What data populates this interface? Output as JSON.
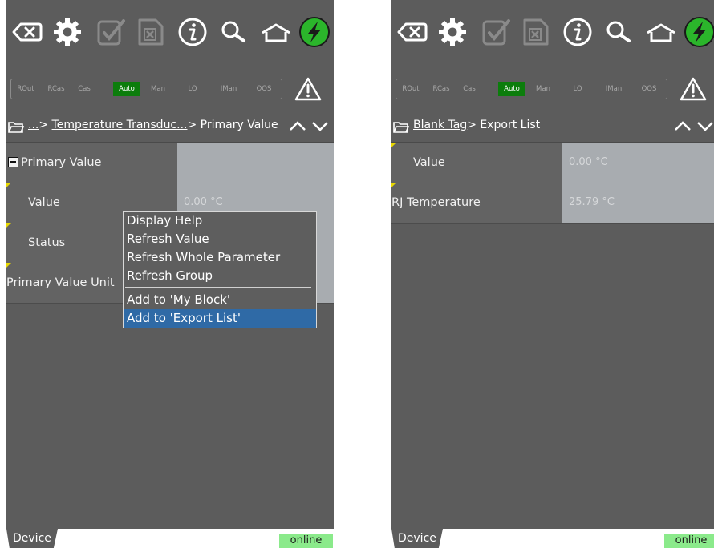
{
  "toolbar": {
    "icons": [
      "backspace-icon",
      "gear-icon",
      "check-document-icon",
      "cancel-document-icon",
      "info-icon",
      "search-icon",
      "home-icon",
      "lightning-icon"
    ]
  },
  "modes": [
    "ROut",
    "RCas",
    "Cas",
    "Auto",
    "Man",
    "LO",
    "IMan",
    "OOS"
  ],
  "active_mode": "Auto",
  "colors": {
    "active_mode": "#0c7d0c",
    "online": "#8bea8b",
    "menu_selected": "#2f6aa6",
    "flag": "#e8d800"
  },
  "left": {
    "breadcrumb": {
      "ellipsis": "...",
      "link": "Temperature Transduc...",
      "sep1": "> ",
      "sep2": "> ",
      "current": "Primary Value"
    },
    "rows": [
      {
        "label": "Primary Value",
        "value": ""
      },
      {
        "label": "Value",
        "value": "0.00 °C"
      },
      {
        "label": "Status",
        "value": ""
      },
      {
        "label": "Primary Value Unit",
        "value": ""
      }
    ],
    "context_menu": {
      "items": [
        "Display Help",
        "Refresh Value",
        "Refresh Whole Parameter",
        "Refresh Group",
        "Add to 'My Block'",
        "Add to 'Export List'"
      ],
      "selected": "Add to 'Export List'"
    }
  },
  "right": {
    "breadcrumb": {
      "link": "Blank Tag",
      "sep": "> ",
      "current": "Export List"
    },
    "rows": [
      {
        "label": "Value",
        "value": "0.00 °C"
      },
      {
        "label": "RJ Temperature",
        "value": "25.79 °C"
      }
    ]
  },
  "footer": {
    "tab": "Device",
    "status": "online"
  }
}
